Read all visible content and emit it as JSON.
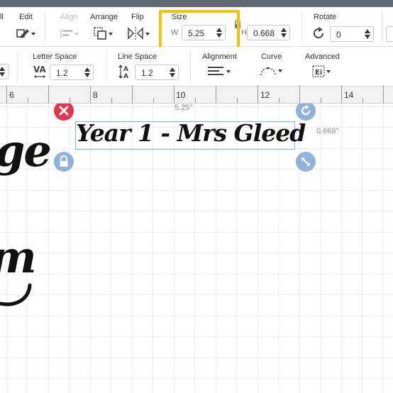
{
  "toolbar": {
    "partial_label": "ll",
    "edit_label": "Edit",
    "align_label": "Align",
    "arrange_label": "Arrange",
    "flip_label": "Flip",
    "size_label": "Size",
    "width_prefix": "W",
    "width_value": "5.25",
    "height_prefix": "H",
    "height_value": "0.668",
    "rotate_label": "Rotate",
    "rotate_value": "0"
  },
  "text_toolbar": {
    "letter_space_label": "Letter Space",
    "letter_space_value": "1.2",
    "line_space_label": "Line Space",
    "line_space_value": "1.2",
    "alignment_label": "Alignment",
    "curve_label": "Curve",
    "advanced_label": "Advanced"
  },
  "ruler": {
    "marks": [
      "6",
      "8",
      "10",
      "12",
      "14"
    ]
  },
  "canvas": {
    "selected_text": "Year 1 - Mrs Gleed",
    "width_readout": "5.25\"",
    "height_readout": "0.668\"",
    "background_text_fragment_1": "ge",
    "background_text_fragment_2": "m"
  },
  "colors": {
    "highlight": "#f2c010",
    "handle_blue": "#8fb1da",
    "delete_red": "#e2374a",
    "grid": "#dedede"
  },
  "icons": [
    "edit-icon",
    "align-icon",
    "arrange-icon",
    "flip-icon",
    "lock-icon",
    "rotate-icon",
    "letter-space-icon",
    "line-space-icon",
    "alignment-icon",
    "curve-icon",
    "advanced-icon",
    "delete-icon",
    "resize-icon"
  ]
}
